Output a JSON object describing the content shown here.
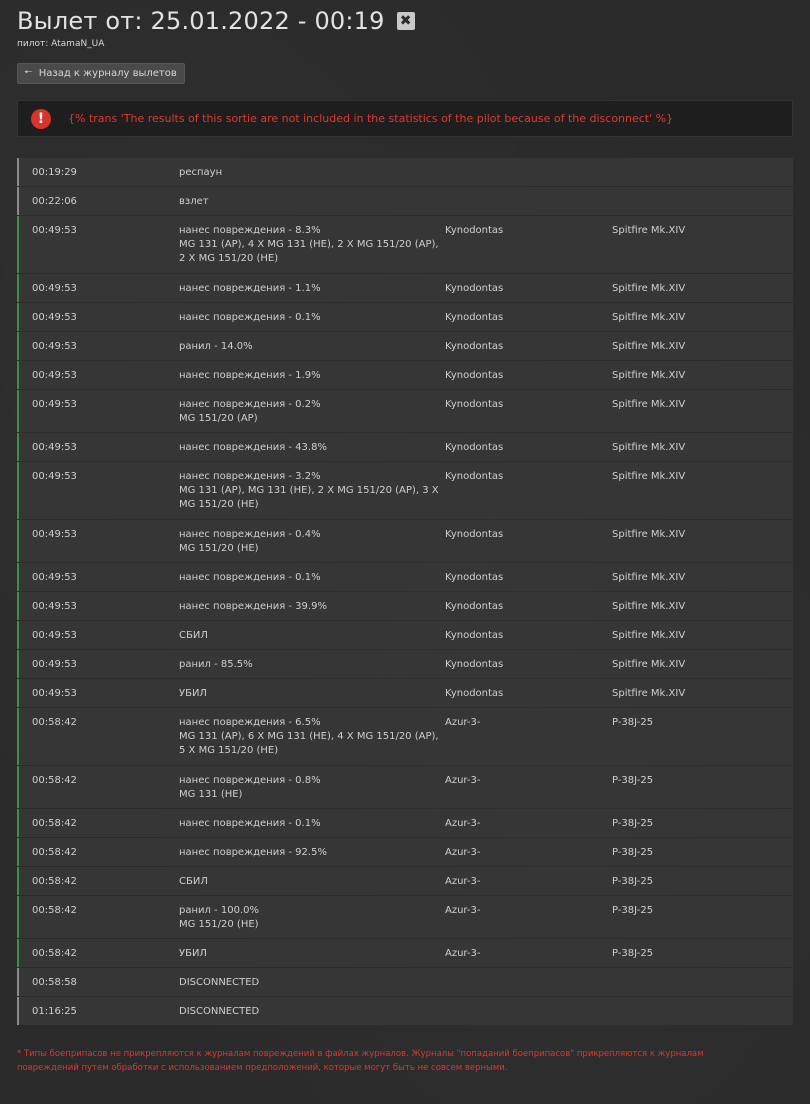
{
  "header": {
    "title": "Вылет от: 25.01.2022 - 00:19",
    "close_glyph": "✖",
    "pilot": "пилот: AtamaN_UA"
  },
  "back_button": {
    "label": "Назад к журналу вылетов",
    "icon": "arrow-left-icon"
  },
  "alert": {
    "icon": "exclamation-icon",
    "glyph": "!",
    "text": "{% trans 'The results of this sortie are not included in the statistics of the pilot because of the disconnect' %}",
    "color": "#e0392f"
  },
  "colors": {
    "damage_border": "#3e8f3e",
    "neutral_border": "#8a8a8a",
    "alert_icon_bg": "#d9342b"
  },
  "log": [
    {
      "time": "00:19:29",
      "event": "респаун",
      "ammo": "",
      "target": "",
      "aircraft": "",
      "type": "neutral"
    },
    {
      "time": "00:22:06",
      "event": "взлет",
      "ammo": "",
      "target": "",
      "aircraft": "",
      "type": "neutral"
    },
    {
      "time": "00:49:53",
      "event": "нанес повреждения - 8.3%",
      "ammo": "MG 131 (AP), 4 X MG 131 (HE), 2 X MG 151/20 (AP), 2 X MG 151/20 (HE)",
      "target": "Kynodontas",
      "aircraft": "Spitfire Mk.XIV",
      "type": "damage"
    },
    {
      "time": "00:49:53",
      "event": "нанес повреждения - 1.1%",
      "ammo": "",
      "target": "Kynodontas",
      "aircraft": "Spitfire Mk.XIV",
      "type": "damage"
    },
    {
      "time": "00:49:53",
      "event": "нанес повреждения - 0.1%",
      "ammo": "",
      "target": "Kynodontas",
      "aircraft": "Spitfire Mk.XIV",
      "type": "damage"
    },
    {
      "time": "00:49:53",
      "event": "ранил - 14.0%",
      "ammo": "",
      "target": "Kynodontas",
      "aircraft": "Spitfire Mk.XIV",
      "type": "damage"
    },
    {
      "time": "00:49:53",
      "event": "нанес повреждения - 1.9%",
      "ammo": "",
      "target": "Kynodontas",
      "aircraft": "Spitfire Mk.XIV",
      "type": "damage"
    },
    {
      "time": "00:49:53",
      "event": "нанес повреждения - 0.2%",
      "ammo": "MG 151/20 (AP)",
      "target": "Kynodontas",
      "aircraft": "Spitfire Mk.XIV",
      "type": "damage"
    },
    {
      "time": "00:49:53",
      "event": "нанес повреждения - 43.8%",
      "ammo": "",
      "target": "Kynodontas",
      "aircraft": "Spitfire Mk.XIV",
      "type": "damage"
    },
    {
      "time": "00:49:53",
      "event": "нанес повреждения - 3.2%",
      "ammo": "MG 131 (AP), MG 131 (HE), 2 X MG 151/20 (AP), 3 X MG 151/20 (HE)",
      "target": "Kynodontas",
      "aircraft": "Spitfire Mk.XIV",
      "type": "damage"
    },
    {
      "time": "00:49:53",
      "event": "нанес повреждения - 0.4%",
      "ammo": "MG 151/20 (HE)",
      "target": "Kynodontas",
      "aircraft": "Spitfire Mk.XIV",
      "type": "damage"
    },
    {
      "time": "00:49:53",
      "event": "нанес повреждения - 0.1%",
      "ammo": "",
      "target": "Kynodontas",
      "aircraft": "Spitfire Mk.XIV",
      "type": "damage"
    },
    {
      "time": "00:49:53",
      "event": "нанес повреждения - 39.9%",
      "ammo": "",
      "target": "Kynodontas",
      "aircraft": "Spitfire Mk.XIV",
      "type": "damage"
    },
    {
      "time": "00:49:53",
      "event": "СБИЛ",
      "ammo": "",
      "target": "Kynodontas",
      "aircraft": "Spitfire Mk.XIV",
      "type": "damage"
    },
    {
      "time": "00:49:53",
      "event": "ранил - 85.5%",
      "ammo": "",
      "target": "Kynodontas",
      "aircraft": "Spitfire Mk.XIV",
      "type": "damage"
    },
    {
      "time": "00:49:53",
      "event": "УБИЛ",
      "ammo": "",
      "target": "Kynodontas",
      "aircraft": "Spitfire Mk.XIV",
      "type": "damage"
    },
    {
      "time": "00:58:42",
      "event": "нанес повреждения - 6.5%",
      "ammo": "MG 131 (AP), 6 X MG 131 (HE), 4 X MG 151/20 (AP), 5 X MG 151/20 (HE)",
      "target": "Azur-3-",
      "aircraft": "P-38J-25",
      "type": "damage"
    },
    {
      "time": "00:58:42",
      "event": "нанес повреждения - 0.8%",
      "ammo": "MG 131 (HE)",
      "target": "Azur-3-",
      "aircraft": "P-38J-25",
      "type": "damage"
    },
    {
      "time": "00:58:42",
      "event": "нанес повреждения - 0.1%",
      "ammo": "",
      "target": "Azur-3-",
      "aircraft": "P-38J-25",
      "type": "damage"
    },
    {
      "time": "00:58:42",
      "event": "нанес повреждения - 92.5%",
      "ammo": "",
      "target": "Azur-3-",
      "aircraft": "P-38J-25",
      "type": "damage"
    },
    {
      "time": "00:58:42",
      "event": "СБИЛ",
      "ammo": "",
      "target": "Azur-3-",
      "aircraft": "P-38J-25",
      "type": "damage"
    },
    {
      "time": "00:58:42",
      "event": "ранил - 100.0%",
      "ammo": "MG 151/20 (HE)",
      "target": "Azur-3-",
      "aircraft": "P-38J-25",
      "type": "damage"
    },
    {
      "time": "00:58:42",
      "event": "УБИЛ",
      "ammo": "",
      "target": "Azur-3-",
      "aircraft": "P-38J-25",
      "type": "damage"
    },
    {
      "time": "00:58:58",
      "event": "DISCONNECTED",
      "ammo": "",
      "target": "",
      "aircraft": "",
      "type": "neutral"
    },
    {
      "time": "01:16:25",
      "event": "DISCONNECTED",
      "ammo": "",
      "target": "",
      "aircraft": "",
      "type": "neutral"
    }
  ],
  "footnote": "* Типы боеприпасов не прикрепляются к журналам повреждений в файлах журналов. Журналы \"попаданий боеприпасов\" прикрепляются к журналам повреждений путем обработки с использованием предположений, которые могут быть не совсем верными."
}
